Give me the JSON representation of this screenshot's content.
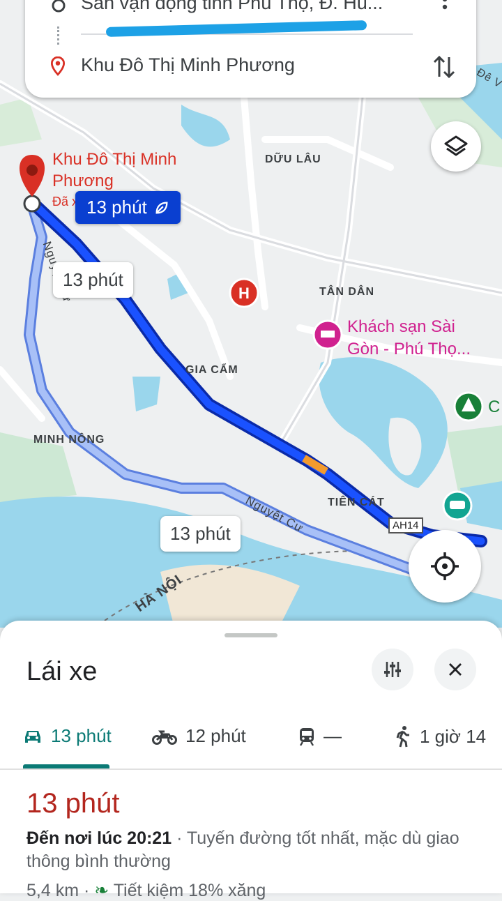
{
  "search": {
    "origin": "Sân vận động tỉnh Phú Thọ, Đ. Hù...",
    "destination": "Khu Đô Thị Minh Phương"
  },
  "map": {
    "areas": [
      "DỮU LÂU",
      "TÂN DÂN",
      "GIA CẨM",
      "MINH NÔNG",
      "TIÊN CÁT",
      "HÀ NỘI"
    ],
    "roads": [
      "Nguyệt Cư",
      "Nguyệt Cư"
    ],
    "road_shield": "AH14",
    "dest_pin_label": "Khu Đô Thị Minh Phương",
    "dest_pin_sub": "Đã x",
    "hotel_label": "Khách sạn Sài Gòn - Phú Thọ...",
    "edge_label_c": "C",
    "edge_label_de": "Đê V",
    "route_times": {
      "selected": "13 phút",
      "alt1": "13 phút",
      "alt2": "13 phút"
    }
  },
  "sheet": {
    "title": "Lái xe",
    "modes": [
      {
        "icon": "car-icon",
        "label": "13 phút"
      },
      {
        "icon": "motorbike-icon",
        "label": "12 phút"
      },
      {
        "icon": "train-icon",
        "label": "—"
      },
      {
        "icon": "walk-icon",
        "label": "1 giờ 14"
      }
    ],
    "duration": "13 phút",
    "arrival_prefix": "Đến nơi lúc 20:21",
    "arrival_rest": " · Tuyến đường tốt nhất, mặc dù giao thông bình thường",
    "distance": "5,4 km",
    "savings": "Tiết kiệm 18% xăng"
  },
  "colors": {
    "route_selected": "#0a3fd0",
    "route_alt": "#a8c0f7",
    "water": "#9ad6ec",
    "accent_teal": "#0b7a75",
    "duration_red": "#b3261e"
  }
}
